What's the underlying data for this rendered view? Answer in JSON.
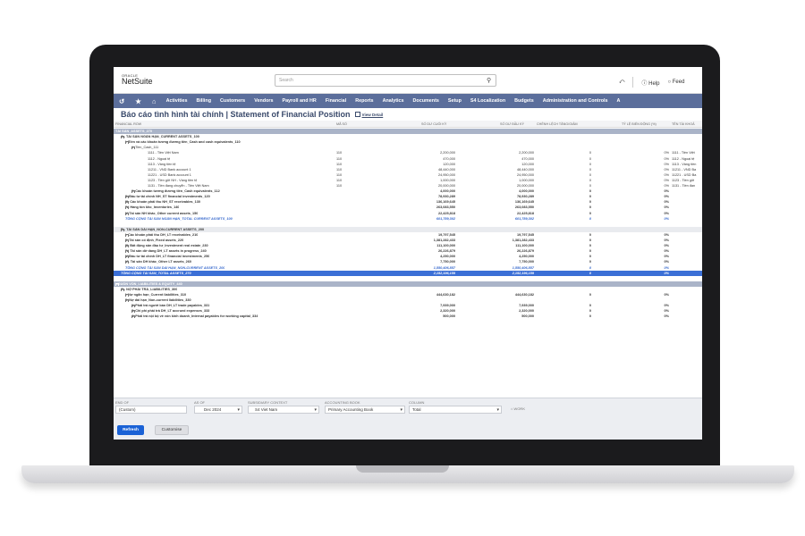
{
  "logo": {
    "top": "ORACLE",
    "bottom": "NetSuite"
  },
  "search": {
    "placeholder": "Search"
  },
  "top_right": {
    "help": "Help",
    "feedback": "Feed"
  },
  "nav": {
    "icons": [
      "recent-icon",
      "star-icon",
      "home-icon"
    ],
    "items": [
      "Activities",
      "Billing",
      "Customers",
      "Vendors",
      "Payroll and HR",
      "Financial",
      "Reports",
      "Analytics",
      "Documents",
      "Setup",
      "S4 Localization",
      "Budgets",
      "Administration and Controls",
      "A"
    ]
  },
  "title": {
    "text": "Báo cáo tình hình tài chính | Statement of Financial Position",
    "view_detail": "View Detail"
  },
  "columns": [
    "FINANCIAL ROW",
    "MÃ SỐ",
    "SỐ DƯ CUỐI KỲ",
    "SỐ DƯ ĐẦU KỲ",
    "CHÊNH LỆCH TĂNG/GIẢM",
    "TỶ LỆ BIẾN ĐỘNG (%)",
    "TÊN TÀI KHOẢ"
  ],
  "rows": [
    {
      "kind": "band",
      "label": "TÀI SẢN_ASSETS_270",
      "ind": 0
    },
    {
      "kind": "bold",
      "label": "A - TÀI SẢN NGẮN HẠN_CURRENT ASSETS_100",
      "ind": 1,
      "toggle": true
    },
    {
      "kind": "bold",
      "label": "I. Tiền và các khoản tương đương tiền_Cash and cash equivalents_110",
      "ind": 2,
      "toggle": true
    },
    {
      "kind": "normal",
      "label": "1. Tiền_Cash_111",
      "ind": 3,
      "toggle": true
    },
    {
      "kind": "normal",
      "label": "1111 - Tiền Việt Nam",
      "ind": 4,
      "code": "110",
      "end": "2,200,000",
      "begin": "2,200,000",
      "diff": "0",
      "pct": "0%",
      "acct": "1111 - Tiền Việt"
    },
    {
      "kind": "normal",
      "label": "1112 - Ngoại tệ",
      "ind": 4,
      "code": "110",
      "end": "470,000",
      "begin": "470,000",
      "diff": "0",
      "pct": "0%",
      "acct": "1112 - Ngoại tệ"
    },
    {
      "kind": "normal",
      "label": "1113 - Vàng tiền tệ",
      "ind": 4,
      "code": "110",
      "end": "120,000",
      "begin": "120,000",
      "diff": "0",
      "pct": "0%",
      "acct": "1113 - Vàng tiền"
    },
    {
      "kind": "normal",
      "label": "11211 - VND Bank account 1",
      "ind": 4,
      "code": "110",
      "end": "48,440,000",
      "begin": "48,440,000",
      "diff": "0",
      "pct": "0%",
      "acct": "11211 - VND Ba"
    },
    {
      "kind": "normal",
      "label": "11221 - USD Bank account 1",
      "ind": 4,
      "code": "110",
      "end": "24,950,000",
      "begin": "24,950,000",
      "diff": "0",
      "pct": "0%",
      "acct": "11221 - USD Ba"
    },
    {
      "kind": "normal",
      "label": "1123 - Tiền gửi NH - Vàng tiền tệ",
      "ind": 4,
      "code": "110",
      "end": "1,000,000",
      "begin": "1,000,000",
      "diff": "0",
      "pct": "0%",
      "acct": "1123 - Tiền gửi"
    },
    {
      "kind": "normal",
      "label": "1131 - Tiền đang chuyển - Tiền Việt Nam",
      "ind": 4,
      "code": "110",
      "end": "20,000,000",
      "begin": "20,000,000",
      "diff": "0",
      "pct": "0%",
      "acct": "1131 - Tiền đan"
    },
    {
      "kind": "bold",
      "label": "2. Các khoản tương đương tiền_Cash equivalents_112",
      "ind": 3,
      "toggle": true,
      "end": "4,000,000",
      "begin": "4,000,000",
      "diff": "0",
      "pct": "0%"
    },
    {
      "kind": "bold",
      "label": "II. Đầu tư tài chính NH_ST financial investments_120",
      "ind": 2,
      "toggle": true,
      "end": "78,930,289",
      "begin": "78,930,289",
      "diff": "0",
      "pct": "0%"
    },
    {
      "kind": "bold",
      "label": "III. Các khoản phải thu NH_ST receivables_130",
      "ind": 2,
      "toggle": true,
      "end": "136,169,645",
      "begin": "136,169,645",
      "diff": "0",
      "pct": "0%"
    },
    {
      "kind": "bold",
      "label": "IV. Hàng tồn kho_Inventories_140",
      "ind": 2,
      "toggle": true,
      "end": "263,083,550",
      "begin": "263,083,550",
      "diff": "0",
      "pct": "0%"
    },
    {
      "kind": "bold",
      "label": "V. Tài sản NH khác_Other current assets_150",
      "ind": 2,
      "toggle": true,
      "end": "22,425,818",
      "begin": "22,425,818",
      "diff": "0",
      "pct": "0%"
    },
    {
      "kind": "total",
      "label": "TỔNG CỘNG TÀI SẢN NGẮN HẠN_TOTAL CURRENT ASSETS_100",
      "ind": 2,
      "end": "601,789,302",
      "begin": "601,789,302",
      "diff": "0",
      "pct": "0%"
    },
    {
      "kind": "spacer",
      "label": ""
    },
    {
      "kind": "sec",
      "label": "B - TÀI SẢN DÀI HẠN_NON-CURRENT ASSETS_200",
      "ind": 1,
      "toggle": true
    },
    {
      "kind": "bold",
      "label": "I. Các khoản phải thu DH_LT receivables_210",
      "ind": 2,
      "toggle": true,
      "end": "19,797,545",
      "begin": "19,797,545",
      "diff": "0",
      "pct": "0%"
    },
    {
      "kind": "bold",
      "label": "II. Tài sản cố định_Fixed assets_220",
      "ind": 2,
      "toggle": true,
      "end": "1,381,282,433",
      "begin": "1,381,282,433",
      "diff": "0",
      "pct": "0%"
    },
    {
      "kind": "bold",
      "label": "III. Bất động sản đầu tư_Investment real estate_230",
      "ind": 2,
      "toggle": true,
      "end": "111,100,000",
      "begin": "111,100,000",
      "diff": "0",
      "pct": "0%"
    },
    {
      "kind": "bold",
      "label": "IV. Tài sản dở dang DH_LT assets in progress_240",
      "ind": 2,
      "toggle": true,
      "end": "26,226,879",
      "begin": "26,226,879",
      "diff": "0",
      "pct": "0%"
    },
    {
      "kind": "bold",
      "label": "V. Đầu tư tài chính DH_LT financial investments_250",
      "ind": 2,
      "toggle": true,
      "end": "4,250,000",
      "begin": "4,250,000",
      "diff": "0",
      "pct": "0%"
    },
    {
      "kind": "bold",
      "label": "VI. Tài sản DH khác_Other LT assets_260",
      "ind": 2,
      "toggle": true,
      "end": "7,750,000",
      "begin": "7,750,000",
      "diff": "0",
      "pct": "0%"
    },
    {
      "kind": "total",
      "label": "TỔNG CỘNG TÀI SẢN DÀI HẠN_NON-CURRENT ASSETS_200",
      "ind": 2,
      "end": "1,550,406,857",
      "begin": "1,550,406,857",
      "diff": "0",
      "pct": "0%"
    },
    {
      "kind": "grand",
      "label": "TỔNG CỘNG TÀI SẢN_TOTAL ASSETS_270",
      "ind": 1,
      "end": "2,152,196,159",
      "begin": "2,152,196,159",
      "diff": "0",
      "pct": "0%"
    },
    {
      "kind": "spacer",
      "label": ""
    },
    {
      "kind": "band",
      "label": "NGUỒN VỐN_LIABILITIES & EQUITY_440",
      "ind": 0,
      "toggle": true
    },
    {
      "kind": "bold",
      "label": "C - NỢ PHẢI TRẢ_LIABILITIES_300",
      "ind": 1,
      "toggle": true
    },
    {
      "kind": "bold",
      "label": "I. Nợ ngắn hạn_Current liabilities_310",
      "ind": 2,
      "toggle": true,
      "end": "444,630,182",
      "begin": "444,630,182",
      "diff": "0",
      "pct": "0%"
    },
    {
      "kind": "bold",
      "label": "II. Nợ dài hạn_Non-current liabilities_330",
      "ind": 2,
      "toggle": true
    },
    {
      "kind": "bold",
      "label": "1. Phải trả người bán DH_LT trade payables_331",
      "ind": 3,
      "toggle": true,
      "end": "7,939,000",
      "begin": "7,939,000",
      "diff": "0",
      "pct": "0%"
    },
    {
      "kind": "bold",
      "label": "3. Chi phí phải trả DH_LT accrued expenses_333",
      "ind": 3,
      "toggle": true,
      "end": "2,320,000",
      "begin": "2,320,000",
      "diff": "0",
      "pct": "0%"
    },
    {
      "kind": "bold",
      "label": "4. Phải trả nội bộ về vốn kinh doanh_Internal payables for working capital_334",
      "ind": 3,
      "toggle": true,
      "end": "500,000",
      "begin": "500,000",
      "diff": "0",
      "pct": "0%"
    }
  ],
  "footer": {
    "fields": [
      {
        "caption": "END OF",
        "value": "(Custom)"
      },
      {
        "caption": "AS OF",
        "value": "Dec 2024"
      },
      {
        "caption": "SUBSIDIARY CONTEXT",
        "value": "S4 Viet Nam"
      },
      {
        "caption": "ACCOUNTING BOOK",
        "value": "Primary Accounting Book"
      },
      {
        "caption": "COLUMN",
        "value": "Total"
      }
    ],
    "work": "WORK",
    "refresh": "Refresh",
    "customise": "Customise"
  },
  "colors": {
    "nav": "#5b6e9b",
    "title": "#3a4a6b",
    "total": "#3366cc",
    "grand_total_bg": "#3b6fd6",
    "band": "#aab4c8",
    "primary_button": "#1a62d6"
  }
}
